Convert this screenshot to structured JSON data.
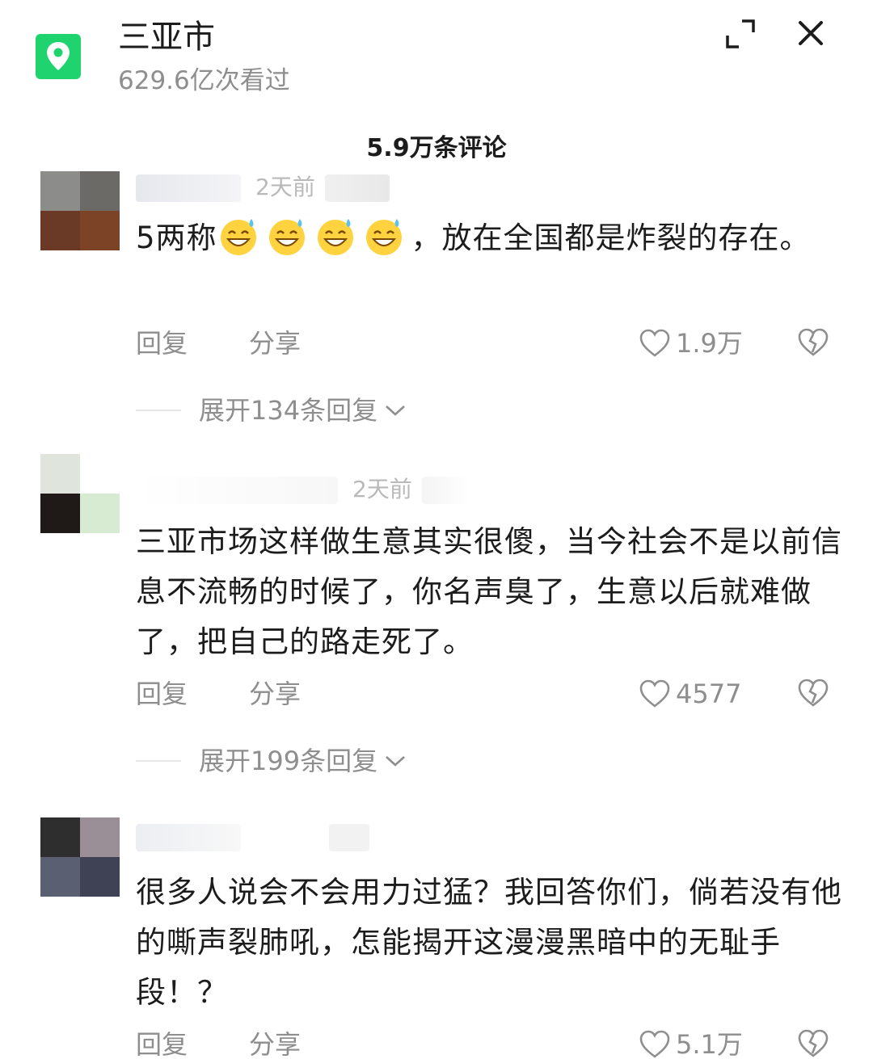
{
  "header": {
    "location_name": "三亚市",
    "views": "629.6亿次看过",
    "accent_color": "#1fd46e"
  },
  "comments_header": {
    "count_label": "5.9万条评论"
  },
  "comments": [
    {
      "time": "2天前",
      "text_prefix": "5两称",
      "text_suffix": "，放在全国都是炸裂的存在。",
      "emoji": "sweat-smile-emoji",
      "reply_label": "回复",
      "share_label": "分享",
      "likes": "1.9万",
      "expand_label": "展开134条回复"
    },
    {
      "time": "2天前",
      "text": "三亚市场这样做生意其实很傻，当今社会不是以前信息不流畅的时候了，你名声臭了，生意以后就难做了，把自己的路走死了。",
      "reply_label": "回复",
      "share_label": "分享",
      "likes": "4577",
      "expand_label": "展开199条回复"
    },
    {
      "text": "很多人说会不会用力过猛？我回答你们，倘若没有他的嘶声裂肺吼，怎能揭开这漫漫黑暗中的无耻手段！？",
      "reply_label": "回复",
      "share_label": "分享",
      "likes": "5.1万"
    }
  ]
}
